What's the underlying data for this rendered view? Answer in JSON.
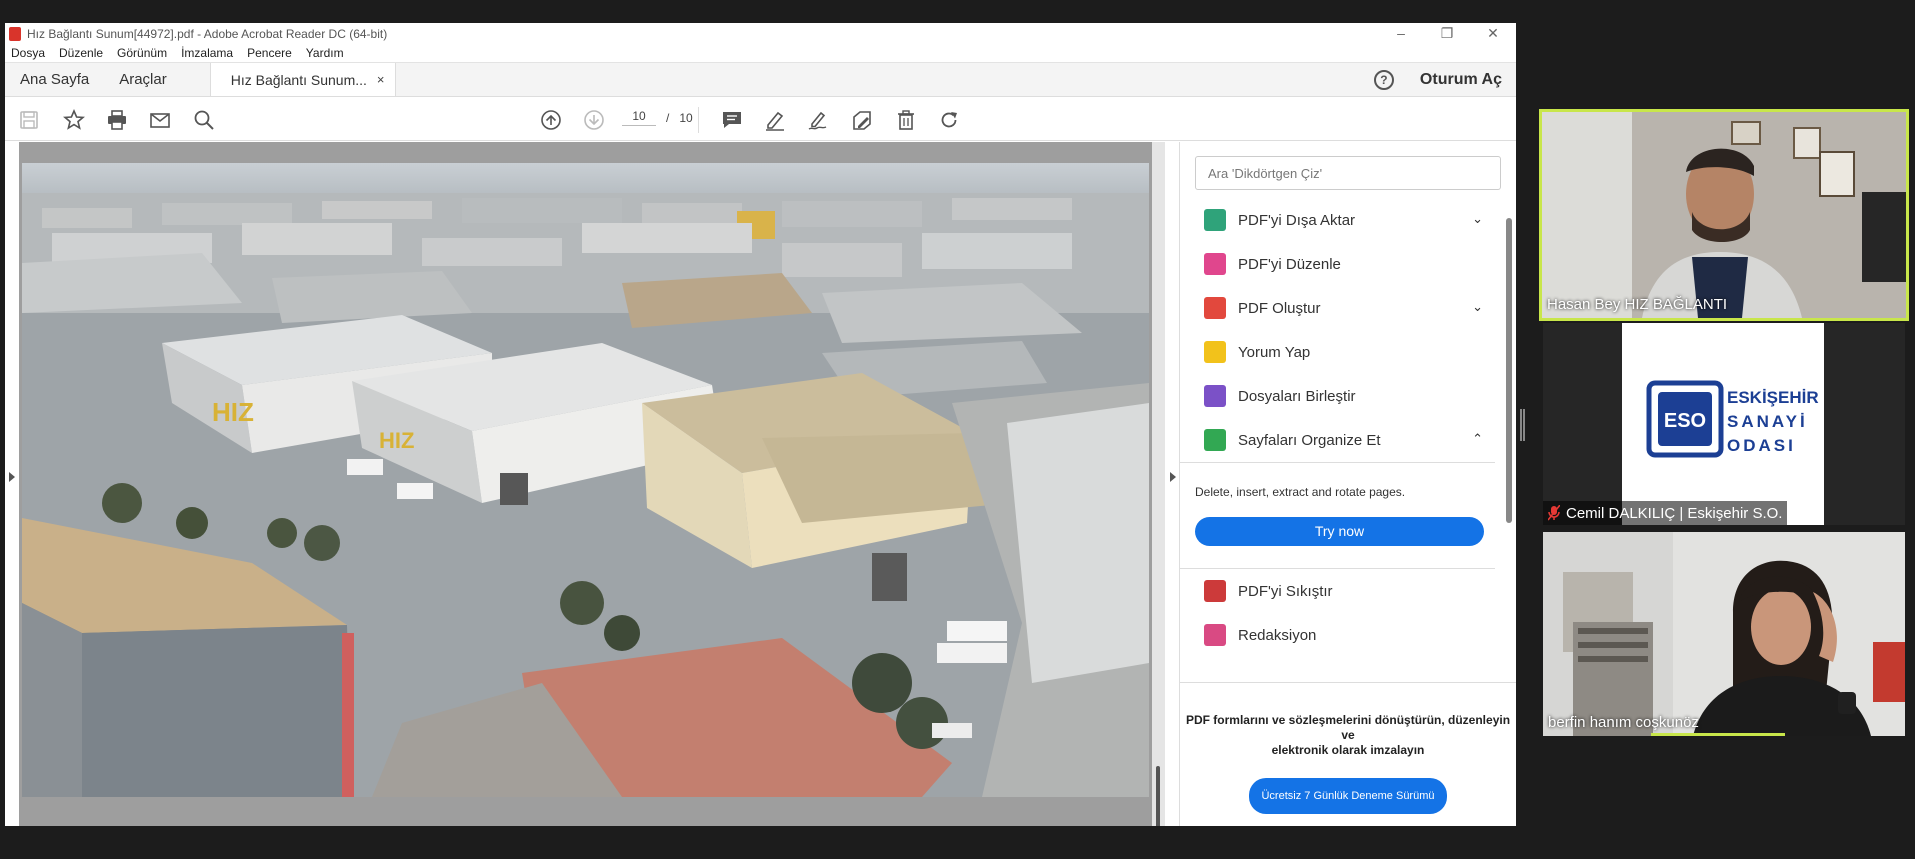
{
  "window": {
    "title": "Hız Bağlantı Sunum[44972].pdf - Adobe Acrobat Reader DC (64-bit)",
    "controls": [
      "–",
      "❐",
      "✕"
    ]
  },
  "menu": [
    "Dosya",
    "Düzenle",
    "Görünüm",
    "İmzalama",
    "Pencere",
    "Yardım"
  ],
  "tabs": {
    "home": "Ana Sayfa",
    "tools": "Araçlar",
    "document": "Hız Bağlantı Sunum...",
    "close": "×",
    "help": "?",
    "sign_in": "Oturum Aç"
  },
  "toolbar": {
    "page_current": "10",
    "page_separator": "/",
    "page_total": "10"
  },
  "right_panel": {
    "search_placeholder": "Ara 'Dikdörtgen Çiz'",
    "tools": [
      {
        "label": "PDF'yi Dışa Aktar",
        "color": "#2fa37a",
        "chevron": "⌄"
      },
      {
        "label": "PDF'yi Düzenle",
        "color": "#e0468d",
        "chevron": ""
      },
      {
        "label": "PDF Oluştur",
        "color": "#e2483d",
        "chevron": "⌄"
      },
      {
        "label": "Yorum Yap",
        "color": "#f2c21b",
        "chevron": ""
      },
      {
        "label": "Dosyaları Birleştir",
        "color": "#7b51c7",
        "chevron": ""
      },
      {
        "label": "Sayfaları Organize Et",
        "color": "#32a853",
        "chevron": "⌃"
      }
    ],
    "organize_description": "Delete, insert, extract and rotate pages.",
    "try_now": "Try now",
    "more_tools": [
      {
        "label": "PDF'yi Sıkıştır",
        "color": "#cc3a3a"
      },
      {
        "label": "Redaksiyon",
        "color": "#d94a83"
      }
    ],
    "promo_line1": "PDF formlarını ve sözleşmelerini dönüştürün, düzenleyin ve",
    "promo_line2": "elektronik olarak imzalayın",
    "promo_button": "Ücretsiz 7 Günlük Deneme Sürümü"
  },
  "document_image": {
    "logo_text_1": "HIZ",
    "logo_text_2": "HIZ"
  },
  "participants": [
    {
      "name": "Hasan Bey HIZ BAĞLANTI",
      "active": true
    },
    {
      "name": "Cemil DALKILIÇ | Eskişehir S.O.",
      "muted": true,
      "logo_short": "ESO",
      "logo_line1": "ESKİŞEHİR",
      "logo_line2": "SANAYİ",
      "logo_line3": "ODASI"
    },
    {
      "name": "berfin hanım coşkunöz"
    }
  ],
  "colors": {
    "accent_blue": "#1473e6",
    "active_speaker": "#c8e64a",
    "muted_red": "#e53935"
  }
}
